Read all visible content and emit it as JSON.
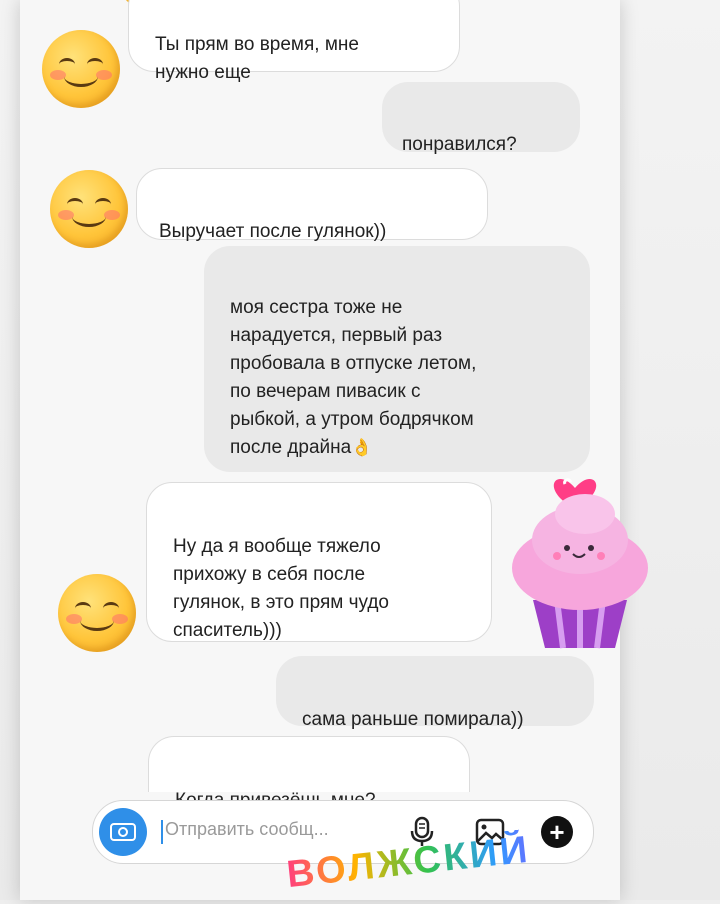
{
  "messages": [
    {
      "side": "incoming",
      "text": "Ты прям во время, мне\nнужно еще"
    },
    {
      "side": "outgoing",
      "text": "понравился?"
    },
    {
      "side": "incoming",
      "text": "Выручает после гулянок))"
    },
    {
      "side": "outgoing",
      "text": "моя сестра тоже не\nнарадуется, первый раз\nпробовала в отпуске летом,\nпо вечерам пивасик с\nрыбкой, а утром бодрячком\nпосле драйна",
      "emoji": "👌"
    },
    {
      "side": "incoming",
      "text": "Ну да я вообще тяжело\nприхожу в себя после\nгулянок, в это прям чудо\nспаситель)))"
    },
    {
      "side": "outgoing",
      "text": "сама раньше помирала))"
    },
    {
      "side": "incoming",
      "text": "Когда привезёшь мне?"
    }
  ],
  "composer": {
    "placeholder": "Отправить сообщ...",
    "icons": [
      "camera-icon",
      "microphone-icon",
      "gallery-icon",
      "plus-icon"
    ]
  },
  "sticker": {
    "text": "ВОЛЖСКИЙ",
    "icon": "cupcake-sticker"
  },
  "colors": {
    "accent": "#2f8fe8",
    "incoming_bg": "#ffffff",
    "outgoing_bg": "#e9e9e9"
  }
}
